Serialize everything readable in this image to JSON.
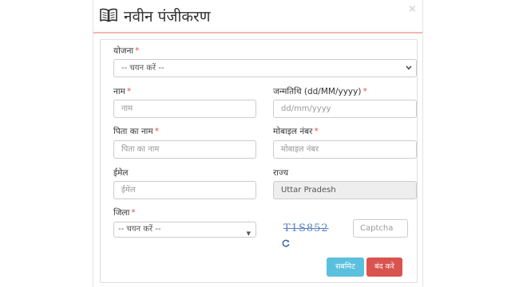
{
  "modal": {
    "title": "नवीन पंजीकरण",
    "close_glyph": "×",
    "title_icon": "book-open-icon"
  },
  "form": {
    "scheme": {
      "label": "योजना",
      "required_mark": "*",
      "selected": "-- चयन करें --"
    },
    "name": {
      "label": "नाम",
      "required_mark": "*",
      "placeholder": "नाम"
    },
    "dob": {
      "label": "जन्मतिथि (dd/MM/yyyy)",
      "required_mark": "*",
      "placeholder": "dd/mm/yyyy"
    },
    "father_name": {
      "label": "पिता का नाम",
      "required_mark": "*",
      "placeholder": "पिता का नाम"
    },
    "mobile": {
      "label": "मोबाइल नंबर",
      "required_mark": "*",
      "placeholder": "मोबाइल नंबर"
    },
    "email": {
      "label": "ईमेल",
      "placeholder": "ईमेल"
    },
    "state": {
      "label": "राज्य",
      "value": "Uttar Pradesh"
    },
    "district": {
      "label": "जिला",
      "required_mark": "*",
      "selected": "-- चयन करें --"
    },
    "captcha": {
      "image_text": "T1S852",
      "placeholder": "Captcha",
      "refresh_icon": "refresh-icon"
    }
  },
  "buttons": {
    "submit": "सबमिट",
    "close": "बंद करे"
  },
  "colors": {
    "submit_button": "#5bc0de",
    "close_button": "#d9534f",
    "required_mark": "#d9534f",
    "header_divider": "#f0b5b5",
    "captcha_text": "#5a7fc0"
  }
}
